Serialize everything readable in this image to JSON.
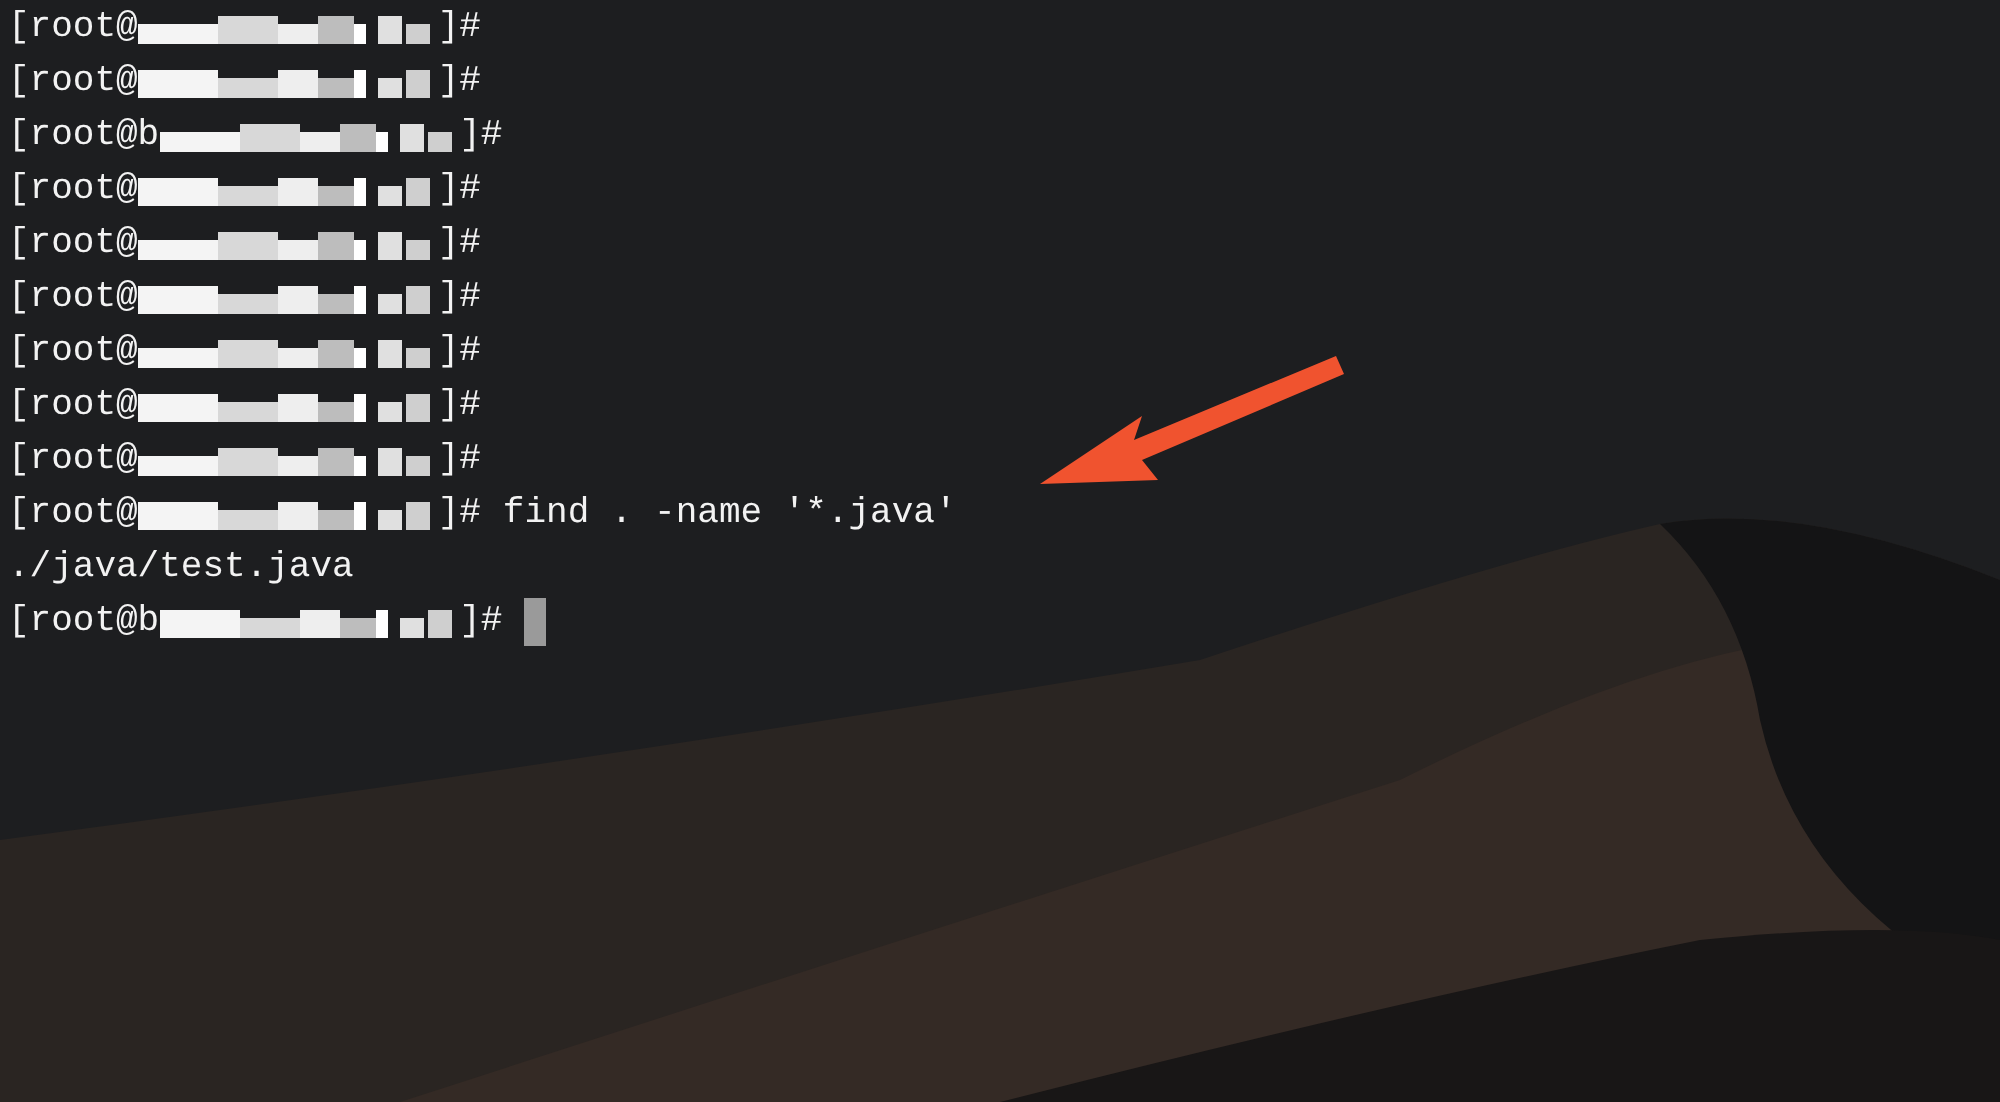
{
  "terminal": {
    "lines": [
      {
        "kind": "prompt",
        "start": "[root@",
        "end": "]#"
      },
      {
        "kind": "prompt",
        "start": "[root@",
        "end": "]#"
      },
      {
        "kind": "prompt",
        "start": "[root@b",
        "end": "]#"
      },
      {
        "kind": "prompt",
        "start": "[root@",
        "end": "]#"
      },
      {
        "kind": "prompt",
        "start": "[root@",
        "end": "]#"
      },
      {
        "kind": "prompt",
        "start": "[root@",
        "end": "]#"
      },
      {
        "kind": "prompt",
        "start": "[root@",
        "end": "]#"
      },
      {
        "kind": "prompt",
        "start": "[root@",
        "end": "]#"
      },
      {
        "kind": "prompt",
        "start": "[root@",
        "end": "]#"
      },
      {
        "kind": "prompt",
        "start": "[root@",
        "end": "]#",
        "command": "find . -name '*.java'"
      },
      {
        "kind": "output",
        "text": "./java/test.java"
      },
      {
        "kind": "prompt",
        "start": "[root@b",
        "end": "]#",
        "cursor": true
      }
    ]
  }
}
